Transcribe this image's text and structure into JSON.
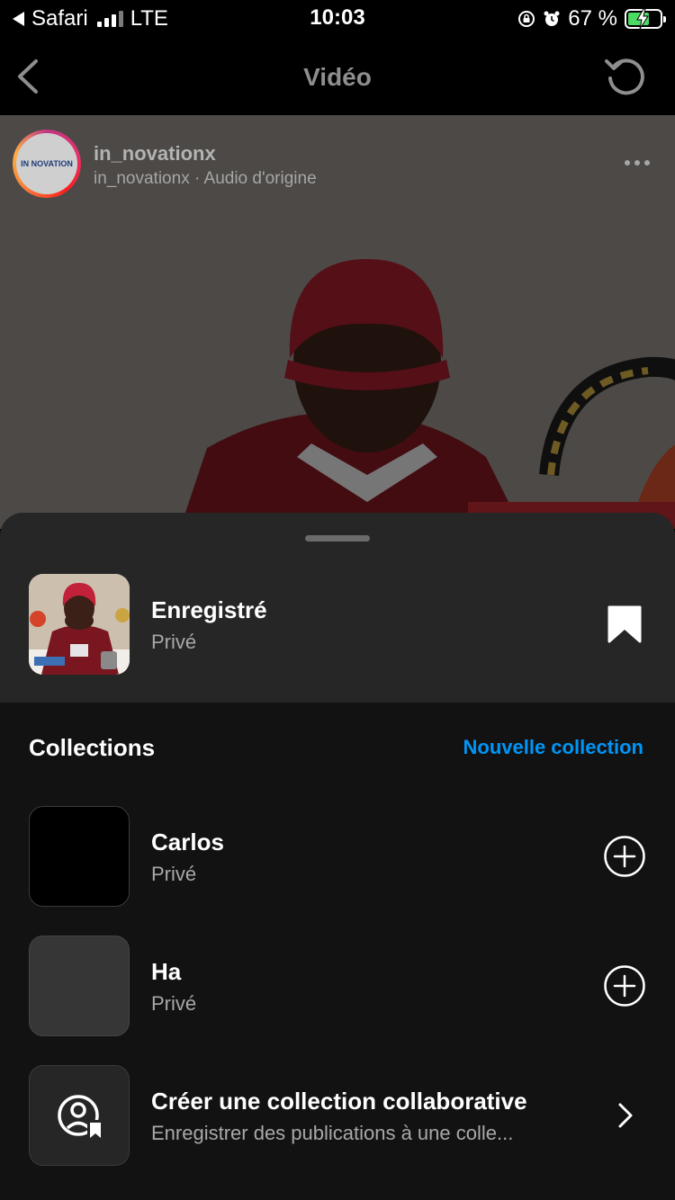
{
  "status_bar": {
    "back_app": "Safari",
    "network": "LTE",
    "time": "10:03",
    "battery": "67 %",
    "battery_level": 0.67,
    "icons": [
      "back-arrow-icon",
      "signal-bars-icon",
      "rotation-lock-icon",
      "alarm-icon",
      "battery-charging-icon"
    ]
  },
  "header": {
    "title": "Vidéo",
    "back_icon": "chevron-left-icon",
    "refresh_icon": "refresh-icon"
  },
  "post": {
    "username": "in_novationx",
    "subtitle": "in_novationx · Audio d'origine",
    "avatar_logo_text": "IN NOVATION",
    "more_icon": "more-dots-icon"
  },
  "saved": {
    "title": "Enregistré",
    "privacy": "Privé",
    "icon": "bookmark-filled-icon"
  },
  "collections": {
    "heading": "Collections",
    "new_label": "Nouvelle collection",
    "items": [
      {
        "title": "Carlos",
        "privacy": "Privé",
        "icon": "plus-circle-icon"
      },
      {
        "title": "Ha",
        "privacy": "Privé",
        "icon": "plus-circle-icon"
      }
    ],
    "collaborative": {
      "title": "Créer une collection collaborative",
      "subtitle": "Enregistrer des publications à une colle...",
      "icon": "collaborative-collection-icon",
      "chevron": "chevron-right-icon"
    }
  },
  "colors": {
    "accent_blue": "#0095f6",
    "sheet_background": "#121212",
    "sheet_header_background": "#262626",
    "battery_green": "#4cd964"
  }
}
